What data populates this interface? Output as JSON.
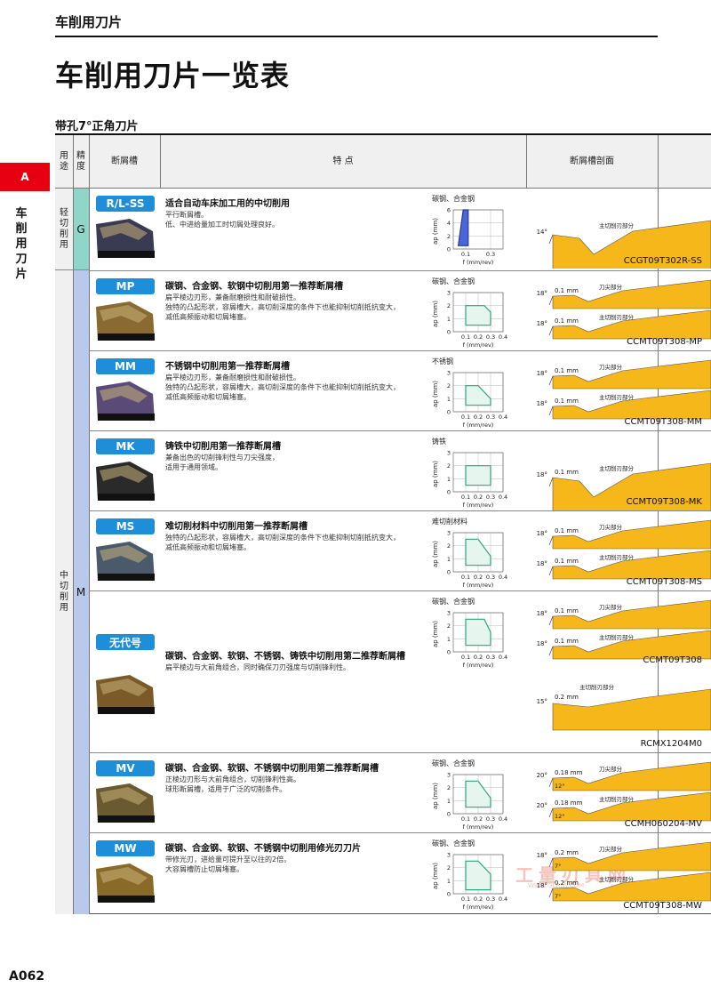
{
  "header": {
    "section": "车削用刀片",
    "title": "车削用刀片一览表",
    "subtitle": "带孔7°正角刀片",
    "side_tab": "A",
    "side_label": "车削用刀片",
    "page_number": "A062"
  },
  "columns": {
    "usage": "用途",
    "grade": "精度",
    "breaker": "断屑槽",
    "features": "特 点",
    "profile": "断屑槽剖面"
  },
  "usage_groups": [
    {
      "label": "轻切削用",
      "grade": "G"
    },
    {
      "label": "中切削用",
      "grade": "M"
    }
  ],
  "axis": {
    "ylabel": "ap (mm)",
    "xlabel": "f (mm/rev)"
  },
  "rows": [
    {
      "badge": "R/L-SS",
      "title": "适合自动车床加工用的中切削用",
      "lines": [
        "平行断屑槽。",
        "低、中进给量加工时切屑处理良好。"
      ],
      "material": "碳钢、合金钢",
      "yticks": [
        "6",
        "4",
        "2",
        "0"
      ],
      "xticks": [
        "0.1",
        "0.3"
      ],
      "profiles": [
        {
          "angle": "14°",
          "width": "",
          "labels": [
            "主切削刃部分"
          ]
        }
      ],
      "code": "CCGT09T302R-SS"
    },
    {
      "badge": "MP",
      "title": "碳钢、合金钢、软钢中切削用第一推荐断屑槽",
      "lines": [
        "扁平棱边刃形，兼备耐磨损性和耐破损性。",
        "独特的凸起形状，容屑槽大，高切削深度的条件下也能抑制切削抵抗变大，",
        "减低高频振动和切屑堵塞。"
      ],
      "material": "碳钢、合金钢",
      "yticks": [
        "3",
        "2",
        "1",
        "0"
      ],
      "xticks": [
        "0.1",
        "0.2",
        "0.3",
        "0.4"
      ],
      "profiles": [
        {
          "angle": "18°",
          "width": "0.1 mm",
          "labels": [
            "刀尖部分"
          ]
        },
        {
          "angle": "18°",
          "width": "0.1 mm",
          "labels": [
            "主切削刃部分"
          ]
        }
      ],
      "code": "CCMT09T308-MP"
    },
    {
      "badge": "MM",
      "title": "不锈钢中切削用第一推荐断屑槽",
      "lines": [
        "扁平棱边刃形，兼备耐磨损性和耐破损性。",
        "独特的凸起形状，容屑槽大，高切削深度的条件下也能抑制切削抵抗变大，",
        "减低高频振动和切屑堵塞。"
      ],
      "material": "不锈钢",
      "yticks": [
        "3",
        "2",
        "1",
        "0"
      ],
      "xticks": [
        "0.1",
        "0.2",
        "0.3",
        "0.4"
      ],
      "profiles": [
        {
          "angle": "18°",
          "width": "0.1 mm",
          "labels": [
            "刀尖部分"
          ]
        },
        {
          "angle": "18°",
          "width": "0.1 mm",
          "labels": [
            "主切削刃部分"
          ]
        }
      ],
      "code": "CCMT09T308-MM"
    },
    {
      "badge": "MK",
      "title": "铸铁中切削用第一推荐断屑槽",
      "lines": [
        "兼备出色的切削锋利性与刀尖强度，",
        "适用于通用领域。"
      ],
      "material": "铸铁",
      "yticks": [
        "3",
        "2",
        "1",
        "0"
      ],
      "xticks": [
        "0.1",
        "0.2",
        "0.3",
        "0.4"
      ],
      "profiles": [
        {
          "angle": "18°",
          "width": "0.1 mm",
          "labels": [
            "主切削刃部分"
          ]
        }
      ],
      "code": "CCMT09T308-MK"
    },
    {
      "badge": "MS",
      "title": "难切削材料中切削用第一推荐断屑槽",
      "lines": [
        "独特的凸起形状，容屑槽大，高切削深度的条件下也能抑制切削抵抗变大，",
        "减低高频振动和切屑堵塞。"
      ],
      "material": "难切削材料",
      "yticks": [
        "3",
        "2",
        "1",
        "0"
      ],
      "xticks": [
        "0.1",
        "0.2",
        "0.3",
        "0.4"
      ],
      "profiles": [
        {
          "angle": "18°",
          "width": "0.1 mm",
          "labels": [
            "刀尖部分"
          ]
        },
        {
          "angle": "18°",
          "width": "0.1 mm",
          "labels": [
            "主切削刃部分"
          ]
        }
      ],
      "code": "CCMT09T308-MS"
    },
    {
      "badge": "无代号",
      "title": "碳钢、合金钢、软钢、不锈钢、铸铁中切削用第二推荐断屑槽",
      "lines": [
        "扁平棱边与大前角组合，同时确保刀刃强度与切削锋利性。"
      ],
      "material": "碳钢、合金钢",
      "yticks": [
        "3",
        "2",
        "1",
        "0"
      ],
      "xticks": [
        "0.1",
        "0.2",
        "0.3",
        "0.4"
      ],
      "profiles": [
        {
          "angle": "18°",
          "width": "0.1 mm",
          "labels": [
            "刀尖部分"
          ]
        },
        {
          "angle": "18°",
          "width": "0.1 mm",
          "labels": [
            "主切削刃部分"
          ]
        }
      ],
      "code": "CCMT09T308",
      "extra_profile": {
        "angle": "15°",
        "width": "0.2 mm",
        "labels": [
          "主切削刃部分"
        ]
      },
      "extra_code": "RCMX1204M0"
    },
    {
      "badge": "MV",
      "title": "碳钢、合金钢、软钢、不锈钢中切削用第二推荐断屑槽",
      "lines": [
        "正棱边刃形与大前角组合，切削锋利性高。",
        "球形断屑槽，适用于广泛的切削条件。"
      ],
      "material": "碳钢、合金钢",
      "yticks": [
        "3",
        "2",
        "1",
        "0"
      ],
      "xticks": [
        "0.1",
        "0.2",
        "0.3",
        "0.4"
      ],
      "profiles": [
        {
          "angle": "20°",
          "width": "0.18 mm",
          "labels": [
            "刀尖部分"
          ],
          "sub": "12°"
        },
        {
          "angle": "20°",
          "width": "0.18 mm",
          "labels": [
            "主切削刃部分"
          ],
          "sub": "12°"
        }
      ],
      "code": "CCMH060204-MV"
    },
    {
      "badge": "MW",
      "title": "碳钢、合金钢、软钢、不锈钢中切削用修光刃刀片",
      "lines": [
        "带修光刃，进给量可提升至以往的2倍。",
        "大容屑槽防止切屑堵塞。"
      ],
      "material": "碳钢、合金钢",
      "yticks": [
        "3",
        "2",
        "1",
        "0"
      ],
      "xticks": [
        "0.1",
        "0.2",
        "0.3",
        "0.4"
      ],
      "profiles": [
        {
          "angle": "18°",
          "width": "0.2 mm",
          "labels": [
            "刀尖部分"
          ],
          "sub": "7°"
        },
        {
          "angle": "18°",
          "width": "0.2 mm",
          "labels": [
            "主切削刃部分"
          ],
          "sub": "7°"
        }
      ],
      "code": "CCMT09T308-MW"
    }
  ],
  "watermark": {
    "main": "工量刃具网",
    "sub": "WWW.GLRJW.COM"
  },
  "colors": {
    "accent": "#e60012",
    "badge": "#1e8ed8",
    "profile_fill": "#f5b719",
    "grade_g": "#8fd6c8",
    "grade_m": "#b9c9ec",
    "region": "#2aa87a"
  }
}
